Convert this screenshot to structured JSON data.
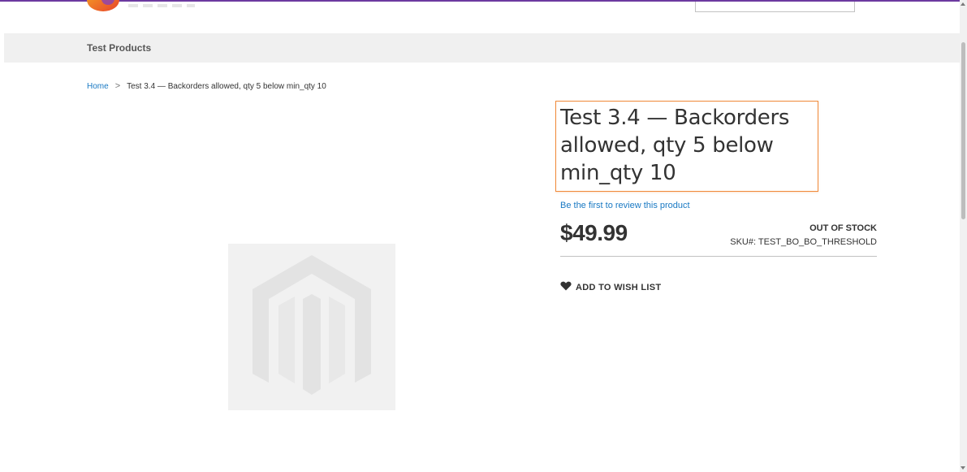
{
  "colors": {
    "accent": "#6c3aa0",
    "link": "#1979c3",
    "highlight_border": "#f08a3b",
    "navbar_bg": "#f0f0f0",
    "image_placeholder_bg": "#f1f1f1"
  },
  "header": {
    "logo_icon": "brand-logo",
    "search": {
      "placeholder": ""
    }
  },
  "nav": {
    "items": [
      {
        "label": "Test Products"
      }
    ]
  },
  "breadcrumb": {
    "home": "Home",
    "separator": ">",
    "current": "Test 3.4 — Backorders allowed, qty 5 below min_qty 10"
  },
  "product": {
    "title": "Test 3.4 — Backorders allowed, qty 5 below min_qty 10",
    "review_link": "Be the first to review this product",
    "price": "$49.99",
    "stock_status": "OUT OF STOCK",
    "sku_label": "SKU#:",
    "sku_value": "TEST_BO_BO_THRESHOLD",
    "image_icon": "magento-placeholder-icon",
    "wishlist": {
      "label": "Add to Wish List",
      "icon": "heart-icon"
    }
  }
}
